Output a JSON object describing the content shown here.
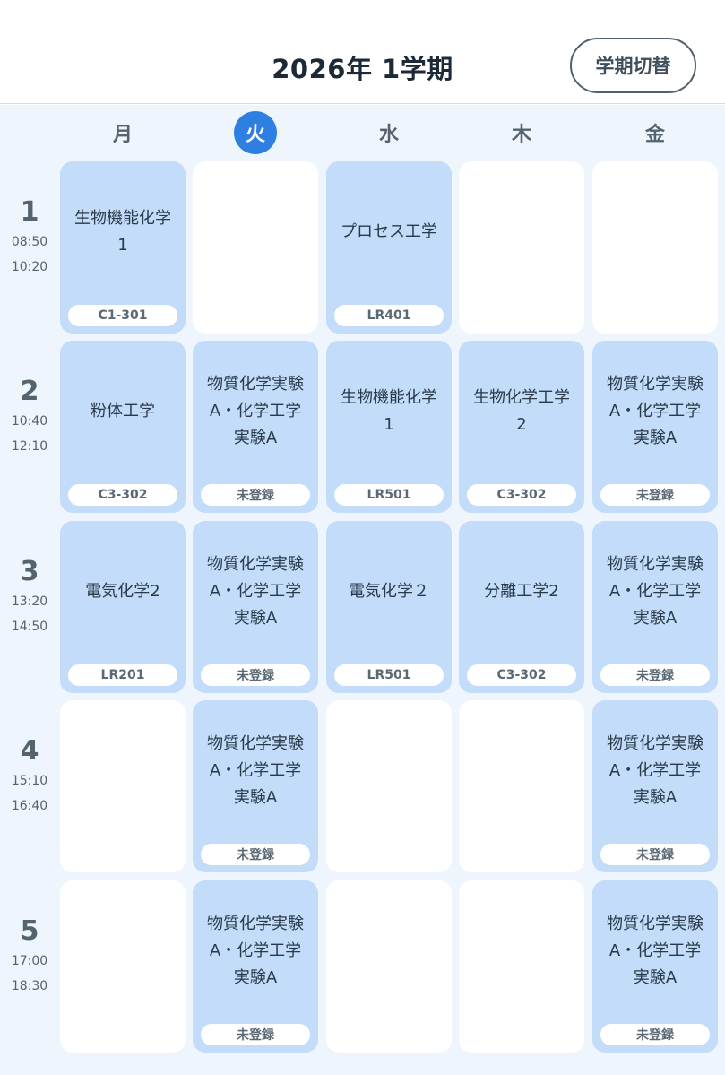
{
  "header": {
    "title": "2026年 1学期",
    "term_switch_label": "学期切替"
  },
  "days": [
    "月",
    "火",
    "水",
    "木",
    "金"
  ],
  "today_index": 1,
  "periods": [
    {
      "num": "1",
      "start": "08:50",
      "end": "10:20"
    },
    {
      "num": "2",
      "start": "10:40",
      "end": "12:10"
    },
    {
      "num": "3",
      "start": "13:20",
      "end": "14:50"
    },
    {
      "num": "4",
      "start": "15:10",
      "end": "16:40"
    },
    {
      "num": "5",
      "start": "17:00",
      "end": "18:30"
    }
  ],
  "grid": [
    [
      {
        "name": "生物機能化学\n1",
        "room": "C1-301"
      },
      null,
      {
        "name": "プロセス工学",
        "room": "LR401"
      },
      null,
      null
    ],
    [
      {
        "name": "粉体工学",
        "room": "C3-302"
      },
      {
        "name": "物質化学実験\nA・化学工学\n実験A",
        "room": "未登録"
      },
      {
        "name": "生物機能化学\n1",
        "room": "LR501"
      },
      {
        "name": "生物化学工学\n2",
        "room": "C3-302"
      },
      {
        "name": "物質化学実験\nA・化学工学\n実験A",
        "room": "未登録"
      }
    ],
    [
      {
        "name": "電気化学2",
        "room": "LR201"
      },
      {
        "name": "物質化学実験\nA・化学工学\n実験A",
        "room": "未登録"
      },
      {
        "name": "電気化学２",
        "room": "LR501"
      },
      {
        "name": "分離工学2",
        "room": "C3-302"
      },
      {
        "name": "物質化学実験\nA・化学工学\n実験A",
        "room": "未登録"
      }
    ],
    [
      null,
      {
        "name": "物質化学実験\nA・化学工学\n実験A",
        "room": "未登録"
      },
      null,
      null,
      {
        "name": "物質化学実験\nA・化学工学\n実験A",
        "room": "未登録"
      }
    ],
    [
      null,
      {
        "name": "物質化学実験\nA・化学工学\n実験A",
        "room": "未登録"
      },
      null,
      null,
      {
        "name": "物質化学実験\nA・化学工学\n実験A",
        "room": "未登録"
      }
    ]
  ],
  "colors": {
    "accent": "#2f7fe3",
    "course_bg": "#c2dcfa",
    "page_bg": "#eef5fd"
  }
}
